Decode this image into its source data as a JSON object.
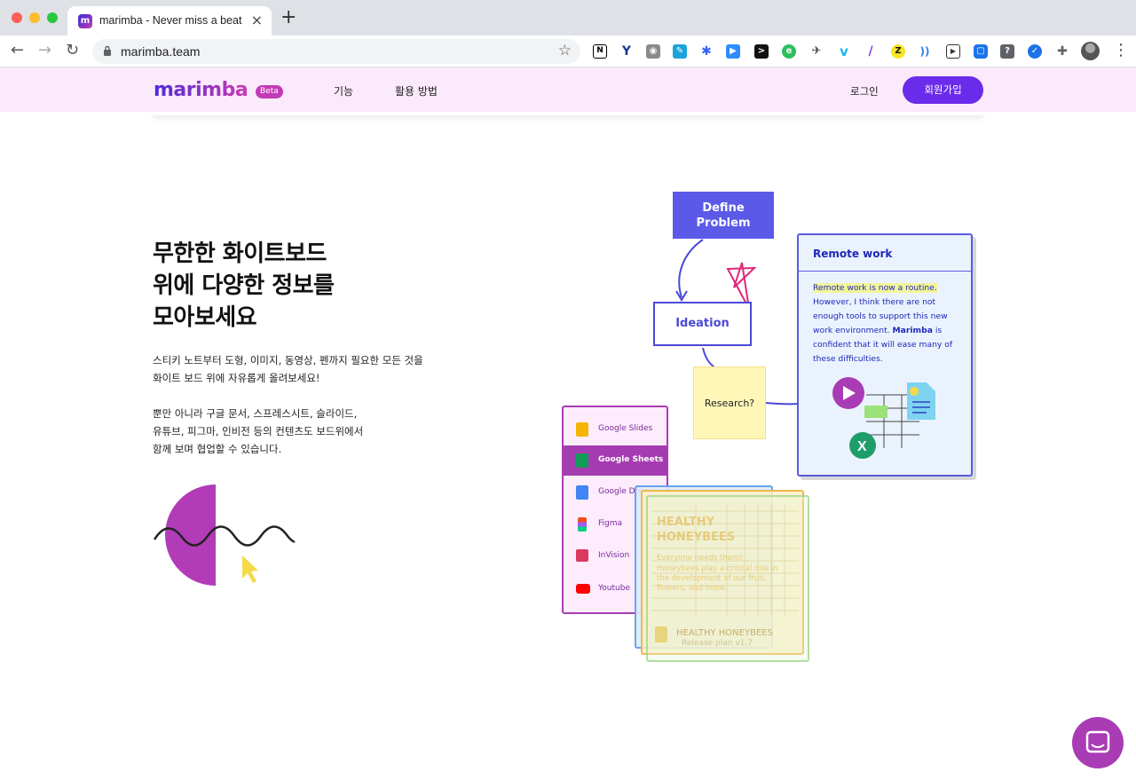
{
  "browser": {
    "tab_title": "marimba - Never miss a beat",
    "tab_favicon": "m",
    "new_tab_label": "+",
    "url": "marimba.team"
  },
  "header": {
    "logo": "marimba",
    "beta_badge": "Beta",
    "nav": [
      "기능",
      "활용 방법"
    ],
    "login": "로그인",
    "signup": "회원가입"
  },
  "hero": {
    "title": "무한한 화이트보드\n위에 다양한 정보를\n모아보세요",
    "p1": "스티키 노트부터 도형, 이미지, 동영상, 펜까지 필요한 모든 것을\n화이트 보드 위에 자유롭게 올려보세요!",
    "p2": "뿐만 아니라 구글 문서, 스프레스시트, 슬라이드,\n유튜브, 피그마, 인비전 등의 컨텐츠도 보드위에서\n함께 보며 협업할 수 있습니다."
  },
  "illustration": {
    "define_problem": "Define\nProblem",
    "ideation": "Ideation",
    "research": "Research?",
    "remote_card": {
      "title": "Remote work",
      "highlight": "Remote work is now a routine.",
      "body_1": "However, I think there are not enough tools to support this new work environment.",
      "brand": "Marimba",
      "body_2": "is confident that it will ease many of these difficulties."
    },
    "apps": [
      {
        "label": "Google Slides",
        "icon": "google-slides-icon",
        "color": "#f4b400"
      },
      {
        "label": "Google Sheets",
        "icon": "google-sheets-icon",
        "color": "#0f9d58"
      },
      {
        "label": "Google Docs",
        "icon": "google-docs-icon",
        "color": "#4285f4"
      },
      {
        "label": "Figma",
        "icon": "figma-icon",
        "color": "#f24e1e"
      },
      {
        "label": "InVision",
        "icon": "invision-icon",
        "color": "#dc395f"
      },
      {
        "label": "Youtube",
        "icon": "youtube-icon",
        "color": "#ff0000"
      }
    ],
    "sheet_card": {
      "heading": "HEALTHY\nHONEYBEES",
      "sub": "Everyone needs them!",
      "body": "Honeybees play a critical role in the development of our fruit, flowers, and more.",
      "footer_title": "HEALTHY HONEYBEES",
      "footer_file": "Release plan v1.7"
    }
  },
  "colors": {
    "accent": "#6b2bea",
    "header_bg": "#fbeafb",
    "brand_purple": "#a93cb4",
    "brand_blue": "#5b5ae8"
  }
}
